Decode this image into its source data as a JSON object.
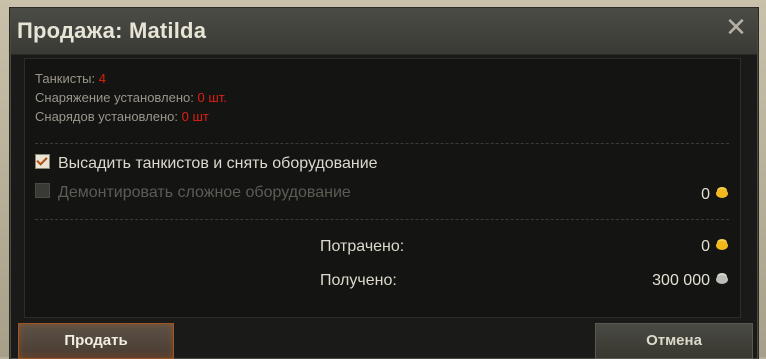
{
  "dialog": {
    "title": "Продажа: Matilda",
    "close_icon": "close-icon"
  },
  "info": {
    "crew_label": "Танкисты:",
    "crew_value": "4",
    "equipment_label": "Снаряжение установлено:",
    "equipment_value": "0 шт.",
    "shells_label": "Снарядов установлено:",
    "shells_value": "0 шт"
  },
  "options": {
    "unload_crew": {
      "label": "Высадить танкистов и снять оборудование",
      "checked": true,
      "enabled": true
    },
    "demount_complex": {
      "label": "Демонтировать сложное оборудование",
      "checked": false,
      "enabled": false,
      "cost": "0",
      "cost_icon": "gold-coin-icon"
    }
  },
  "summary": {
    "spent_label": "Потрачено:",
    "spent_value": "0",
    "spent_icon": "gold-coin-icon",
    "received_label": "Получено:",
    "received_value": "300 000",
    "received_icon": "silver-coin-icon"
  },
  "buttons": {
    "sell_label": "Продать",
    "cancel_label": "Отмена"
  },
  "colors": {
    "warning": "#e01e12",
    "gold": "#f2b91e",
    "silver": "#bdbdb8"
  }
}
